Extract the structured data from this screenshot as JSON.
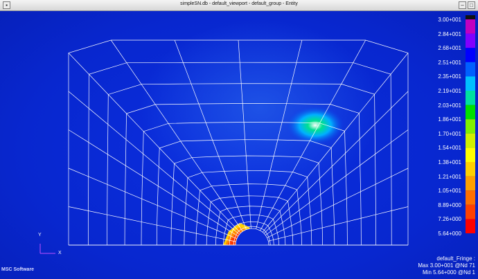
{
  "window": {
    "title": "simpleSN.db - default_viewport - default_group - Entity"
  },
  "legend": {
    "values": [
      "3.00+001",
      "2.84+001",
      "2.68+001",
      "2.51+001",
      "2.35+001",
      "2.19+001",
      "2.03+001",
      "1.86+001",
      "1.70+001",
      "1.54+001",
      "1.38+001",
      "1.21+001",
      "1.05+001",
      "8.89+000",
      "7.26+000",
      "5.64+000"
    ],
    "colors": [
      "#f0f0f0",
      "#c000c0",
      "#8000ff",
      "#0000ff",
      "#0060ff",
      "#00c0ff",
      "#00e0a0",
      "#00e000",
      "#80f000",
      "#d0f000",
      "#ffff00",
      "#ffd000",
      "#ffa000",
      "#ff7000",
      "#ff4000",
      "#ff0000"
    ]
  },
  "fringe": {
    "name": "default_Fringe :",
    "max": "Max 3.00+001 @Nd 71",
    "min": "Min 5.64+000 @Nd 1"
  },
  "axis": {
    "y": "Y",
    "x": "X"
  },
  "logo": "MSC Software"
}
